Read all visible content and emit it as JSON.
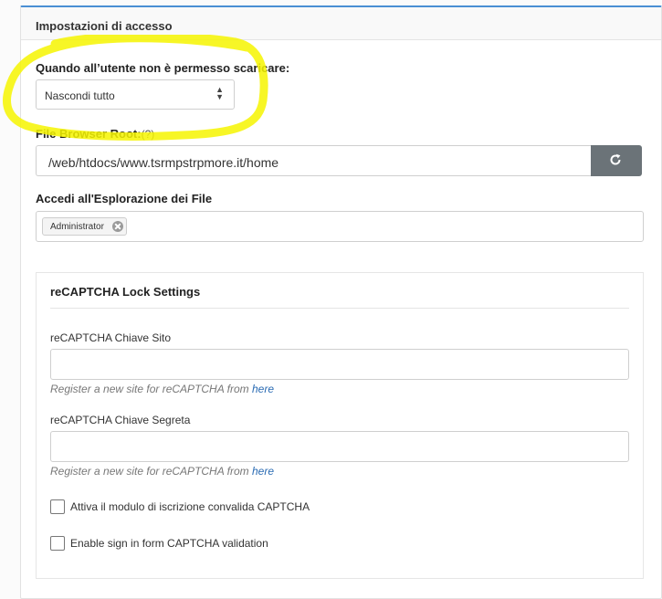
{
  "panel": {
    "title": "Impostazioni di accesso"
  },
  "download": {
    "label": "Quando all’utente non è permesso scaricare:",
    "select_value": "Nascondi tutto"
  },
  "root": {
    "label": "File Browser Root:",
    "hint": "(?)",
    "value": "/web/htdocs/www.tsrmpstrpmore.it/home"
  },
  "access": {
    "label": "Accedi all'Esplorazione dei File",
    "tags": [
      "Administrator"
    ]
  },
  "recaptcha": {
    "title": "reCAPTCHA Lock Settings",
    "site_key_label": "reCAPTCHA Chiave Sito",
    "site_key_value": "",
    "site_help_text": "Register a new site for reCAPTCHA from",
    "site_help_link": "here",
    "secret_key_label": "reCAPTCHA Chiave Segreta",
    "secret_key_value": "",
    "secret_help_text": "Register a new site for reCAPTCHA from",
    "secret_help_link": "here",
    "checkbox_signup_label": "Attiva il modulo di iscrizione convalida CAPTCHA",
    "checkbox_signin_label": "Enable sign in form CAPTCHA validation"
  },
  "icons": {
    "refresh": "refresh-icon",
    "remove_tag": "close-icon",
    "select": "chevron-up-down-icon"
  },
  "colors": {
    "accent": "#4a8fd4",
    "button": "#6b7378",
    "highlight": "#f6f500",
    "link": "#2a6bb3"
  }
}
